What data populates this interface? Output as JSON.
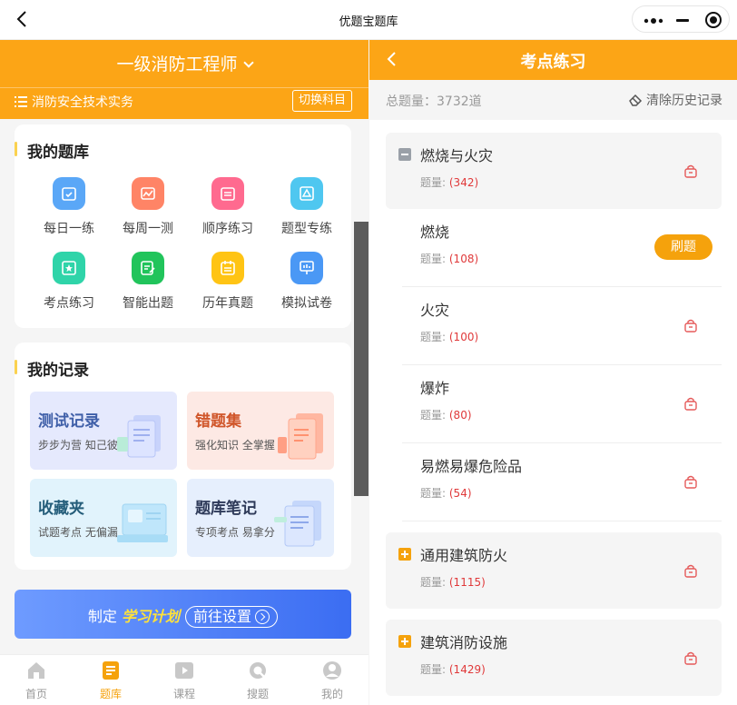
{
  "window": {
    "title": "优题宝题库"
  },
  "left": {
    "exam_name": "一级消防工程师",
    "subject": "消防安全技术实务",
    "switch_label": "切换科目",
    "bank": {
      "title": "我的题库",
      "items": [
        {
          "label": "每日一练",
          "icon": "calendar-check-icon",
          "color": "#5aa7f7"
        },
        {
          "label": "每周一测",
          "icon": "chart-line-icon",
          "color": "#ff8466"
        },
        {
          "label": "顺序练习",
          "icon": "list-icon",
          "color": "#ff6a8f"
        },
        {
          "label": "题型专练",
          "icon": "triangle-icon",
          "color": "#4fc7f0"
        },
        {
          "label": "考点练习",
          "icon": "star-badge-icon",
          "color": "#2fd4a9"
        },
        {
          "label": "智能出题",
          "icon": "edit-doc-icon",
          "color": "#21c45b"
        },
        {
          "label": "历年真题",
          "icon": "calendar-icon",
          "color": "#ffc414"
        },
        {
          "label": "模拟试卷",
          "icon": "presentation-icon",
          "color": "#4a98f5"
        }
      ]
    },
    "records": {
      "title": "我的记录",
      "items": [
        {
          "title": "测试记录",
          "sub": "步步为营 知己彼",
          "color": "#3f5fa8",
          "bg": "#e5e9fd"
        },
        {
          "title": "错题集",
          "sub": "强化知识 全掌握",
          "color": "#d0562a",
          "bg": "#fde9e4"
        },
        {
          "title": "收藏夹",
          "sub": "试题考点 无偏漏",
          "color": "#245d7a",
          "bg": "#e1f3fc"
        },
        {
          "title": "题库笔记",
          "sub": "专项考点 易拿分",
          "color": "#2e3a59",
          "bg": "#e6effd"
        }
      ]
    },
    "banner": {
      "prefix": "制定",
      "highlight": "学习计划",
      "button": "前往设置"
    },
    "tabs": [
      {
        "label": "首页",
        "icon": "home-icon"
      },
      {
        "label": "题库",
        "icon": "question-bank-icon",
        "active": true
      },
      {
        "label": "课程",
        "icon": "video-play-icon"
      },
      {
        "label": "搜题",
        "icon": "search-icon"
      },
      {
        "label": "我的",
        "icon": "user-icon"
      }
    ]
  },
  "right": {
    "title": "考点练习",
    "total": "总题量：3732道",
    "clear": "清除历史记录",
    "count_label": "题量:",
    "practice_label": "刷题",
    "nodes": [
      {
        "name": "燃烧与火灾",
        "count": "(342)",
        "type": "parent-open"
      },
      {
        "name": "燃烧",
        "count": "(108)",
        "type": "child-active"
      },
      {
        "name": "火灾",
        "count": "(100)",
        "type": "child"
      },
      {
        "name": "爆炸",
        "count": "(80)",
        "type": "child"
      },
      {
        "name": "易燃易爆危险品",
        "count": "(54)",
        "type": "child"
      },
      {
        "name": "通用建筑防火",
        "count": "(1115)",
        "type": "parent-closed"
      },
      {
        "name": "建筑消防设施",
        "count": "(1429)",
        "type": "parent-closed"
      }
    ]
  }
}
